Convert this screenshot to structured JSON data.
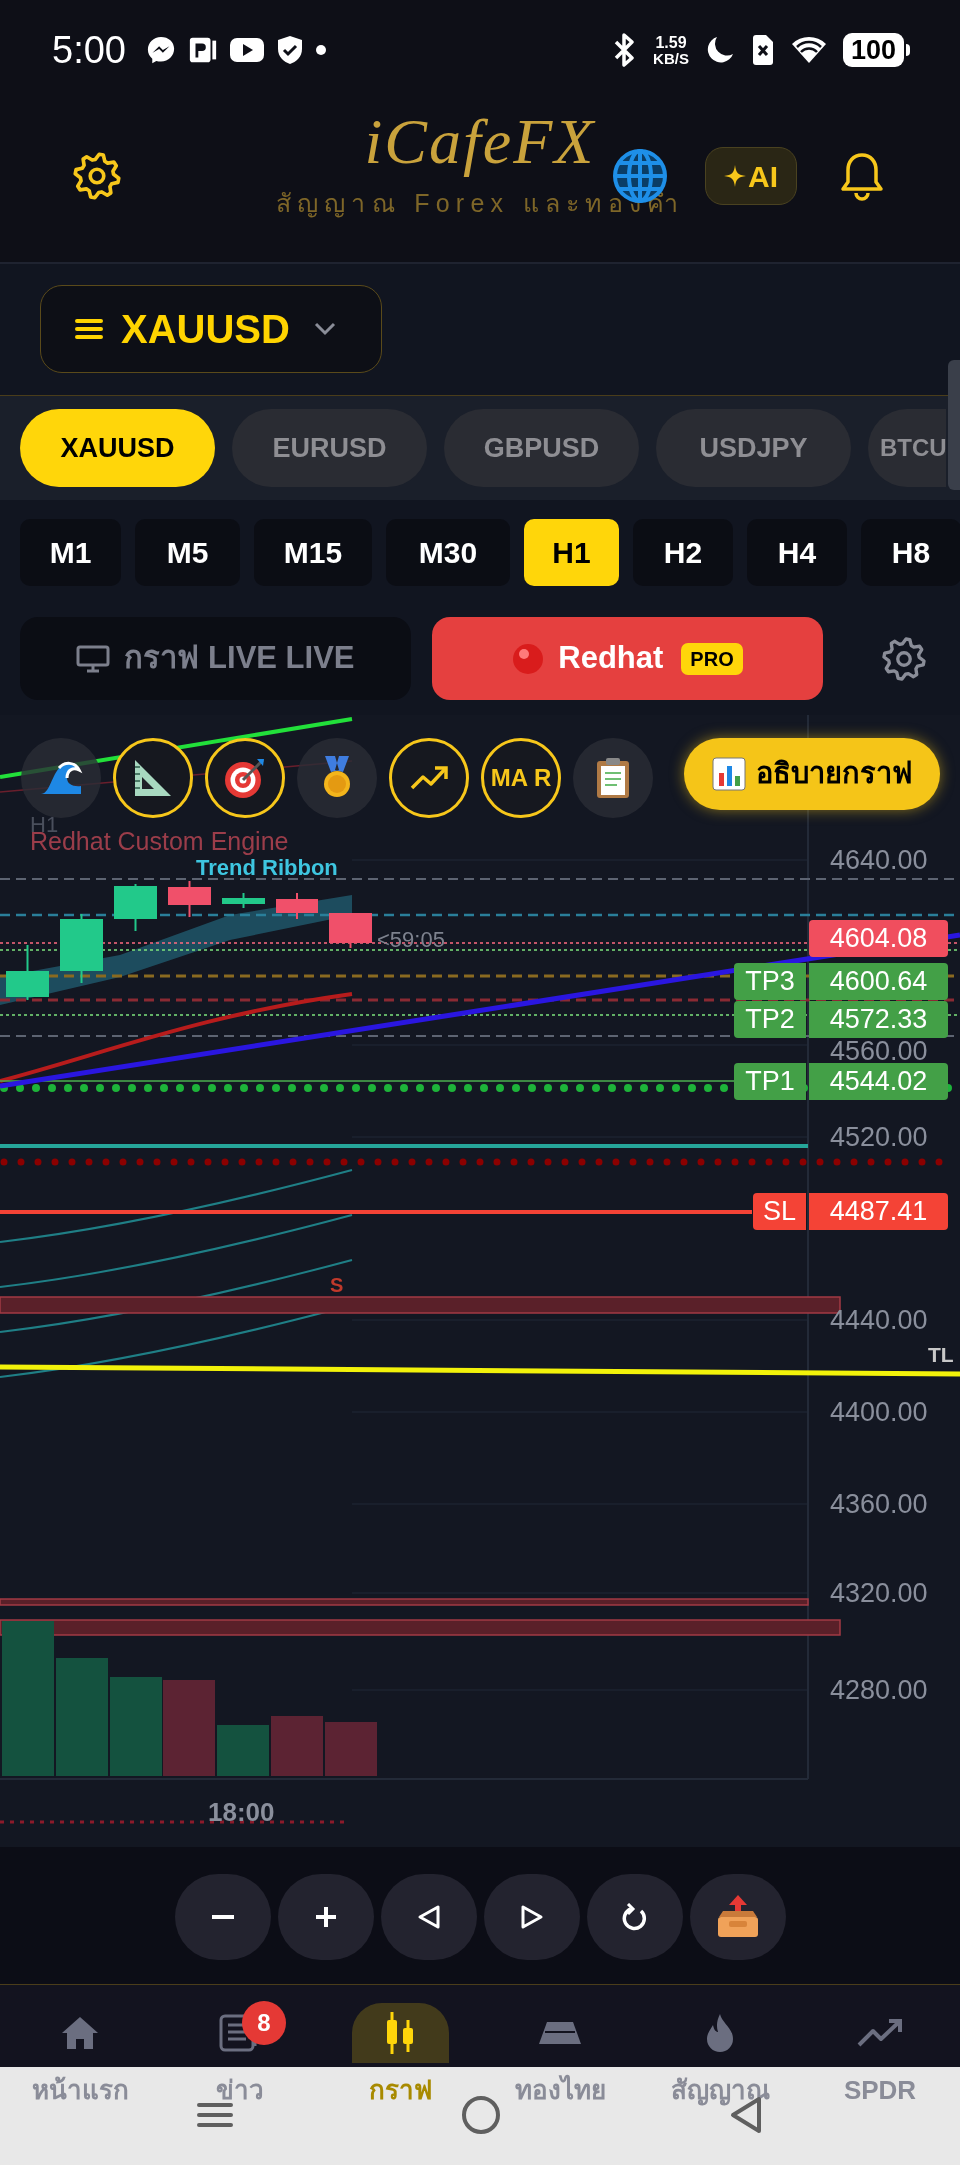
{
  "status_bar": {
    "time": "5:00",
    "speed_value": "1.59",
    "speed_unit": "KB/S",
    "battery": "100"
  },
  "header": {
    "logo": "iCafeFX",
    "tagline": "สัญญาณ Forex และทองคำ",
    "ai_button": "AI"
  },
  "symbol_selector": {
    "value": "XAUUSD"
  },
  "pairs": [
    {
      "label": "XAUUSD",
      "selected": true
    },
    {
      "label": "EURUSD",
      "selected": false
    },
    {
      "label": "GBPUSD",
      "selected": false
    },
    {
      "label": "USDJPY",
      "selected": false
    },
    {
      "label": "BTCU",
      "selected": false
    }
  ],
  "timeframes": [
    {
      "label": "M1",
      "selected": false
    },
    {
      "label": "M5",
      "selected": false
    },
    {
      "label": "M15",
      "selected": false
    },
    {
      "label": "M30",
      "selected": false
    },
    {
      "label": "H1",
      "selected": true
    },
    {
      "label": "H2",
      "selected": false
    },
    {
      "label": "H4",
      "selected": false
    },
    {
      "label": "H8",
      "selected": false
    }
  ],
  "modes": [
    {
      "kind": "live",
      "label": "กราฟ LIVE LIVE",
      "selected": false
    },
    {
      "kind": "redhat",
      "label": "Redhat",
      "badge": "PRO",
      "selected": true
    }
  ],
  "chart": {
    "toolbar": [
      {
        "kind": "wave",
        "on": false
      },
      {
        "kind": "ruler",
        "on": true
      },
      {
        "kind": "target",
        "on": true
      },
      {
        "kind": "medal",
        "on": false
      },
      {
        "kind": "trend",
        "on": true
      },
      {
        "kind": "text",
        "label": "MA R",
        "on": true
      },
      {
        "kind": "clipboard",
        "on": false
      }
    ],
    "explain_button": "อธิบายกราฟ",
    "timeframe_label": "H1",
    "engine_label": "Redhat Custom Engine",
    "indicator_label": "Trend Ribbon",
    "countdown": "<59:05",
    "zone_label": "S",
    "trendline_label": "TL",
    "price_axis": [
      "4640.00",
      "4560.00",
      "4520.00",
      "4440.00",
      "4400.00",
      "4360.00",
      "4320.00",
      "4280.00"
    ],
    "price_tags": [
      {
        "kind": "current",
        "value": "4604.08"
      },
      {
        "kind": "tp",
        "label": "TP3",
        "value": "4600.64"
      },
      {
        "kind": "tp",
        "label": "TP2",
        "value": "4572.33"
      },
      {
        "kind": "tp",
        "label": "TP1",
        "value": "4544.02"
      },
      {
        "kind": "sl",
        "label": "SL",
        "value": "4487.41"
      }
    ],
    "time_axis": [
      "18:00"
    ]
  },
  "bottom_nav": [
    {
      "kind": "home",
      "label": "หน้าแรก",
      "selected": false
    },
    {
      "kind": "news",
      "label": "ข่าว",
      "badge": "8",
      "selected": false
    },
    {
      "kind": "chart",
      "label": "กราฟ",
      "selected": true
    },
    {
      "kind": "gold",
      "label": "ทองไทย",
      "selected": false
    },
    {
      "kind": "signal",
      "label": "สัญญาณ",
      "selected": false
    },
    {
      "kind": "trend",
      "label": "SPDR",
      "selected": false
    }
  ]
}
